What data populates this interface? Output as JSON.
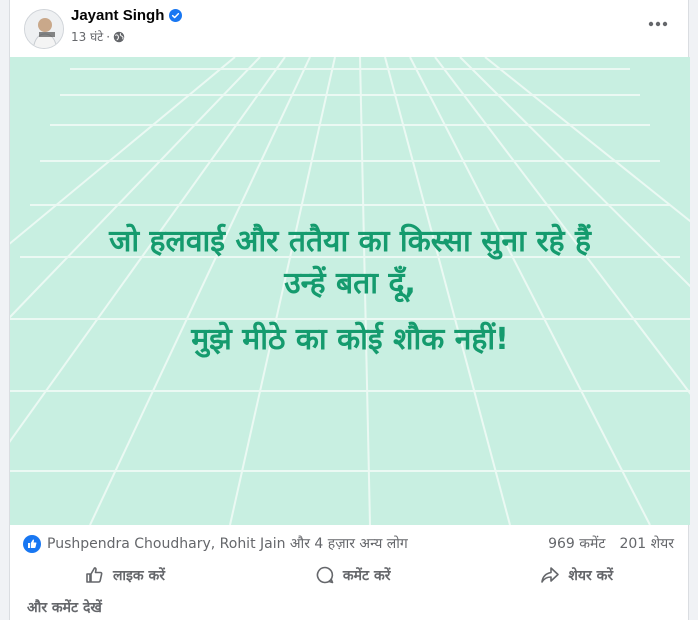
{
  "post": {
    "author": "Jayant Singh",
    "time": "13 घंटे",
    "separator": "·",
    "lines": [
      "जो हलवाई और ततैया का किस्सा सुना रहे हैं",
      "उन्हें बता दूँ,",
      "मुझे मीठे का कोई शौक नहीं!"
    ],
    "text_color": "#159b6e",
    "background_color": "#c8efe1"
  },
  "reactions": {
    "likers": "Pushpendra Choudhary, Rohit Jain और 4 हज़ार अन्य लोग",
    "comments": "969 कमेंट",
    "shares": "201 शेयर"
  },
  "actions": {
    "like": "लाइक करें",
    "comment": "कमेंट करें",
    "share": "शेयर करें"
  },
  "footer": {
    "more_comments": "और कमेंट देखें"
  },
  "icons": {
    "verified": "verified-badge-icon",
    "audience": "globe-icon",
    "more": "more-options-icon",
    "like_reaction": "like-reaction-icon",
    "like": "thumbs-up-icon",
    "comment": "comment-bubble-icon",
    "share": "share-arrow-icon"
  },
  "colors": {
    "accent": "#1877f2",
    "secondary_text": "#65676b"
  }
}
